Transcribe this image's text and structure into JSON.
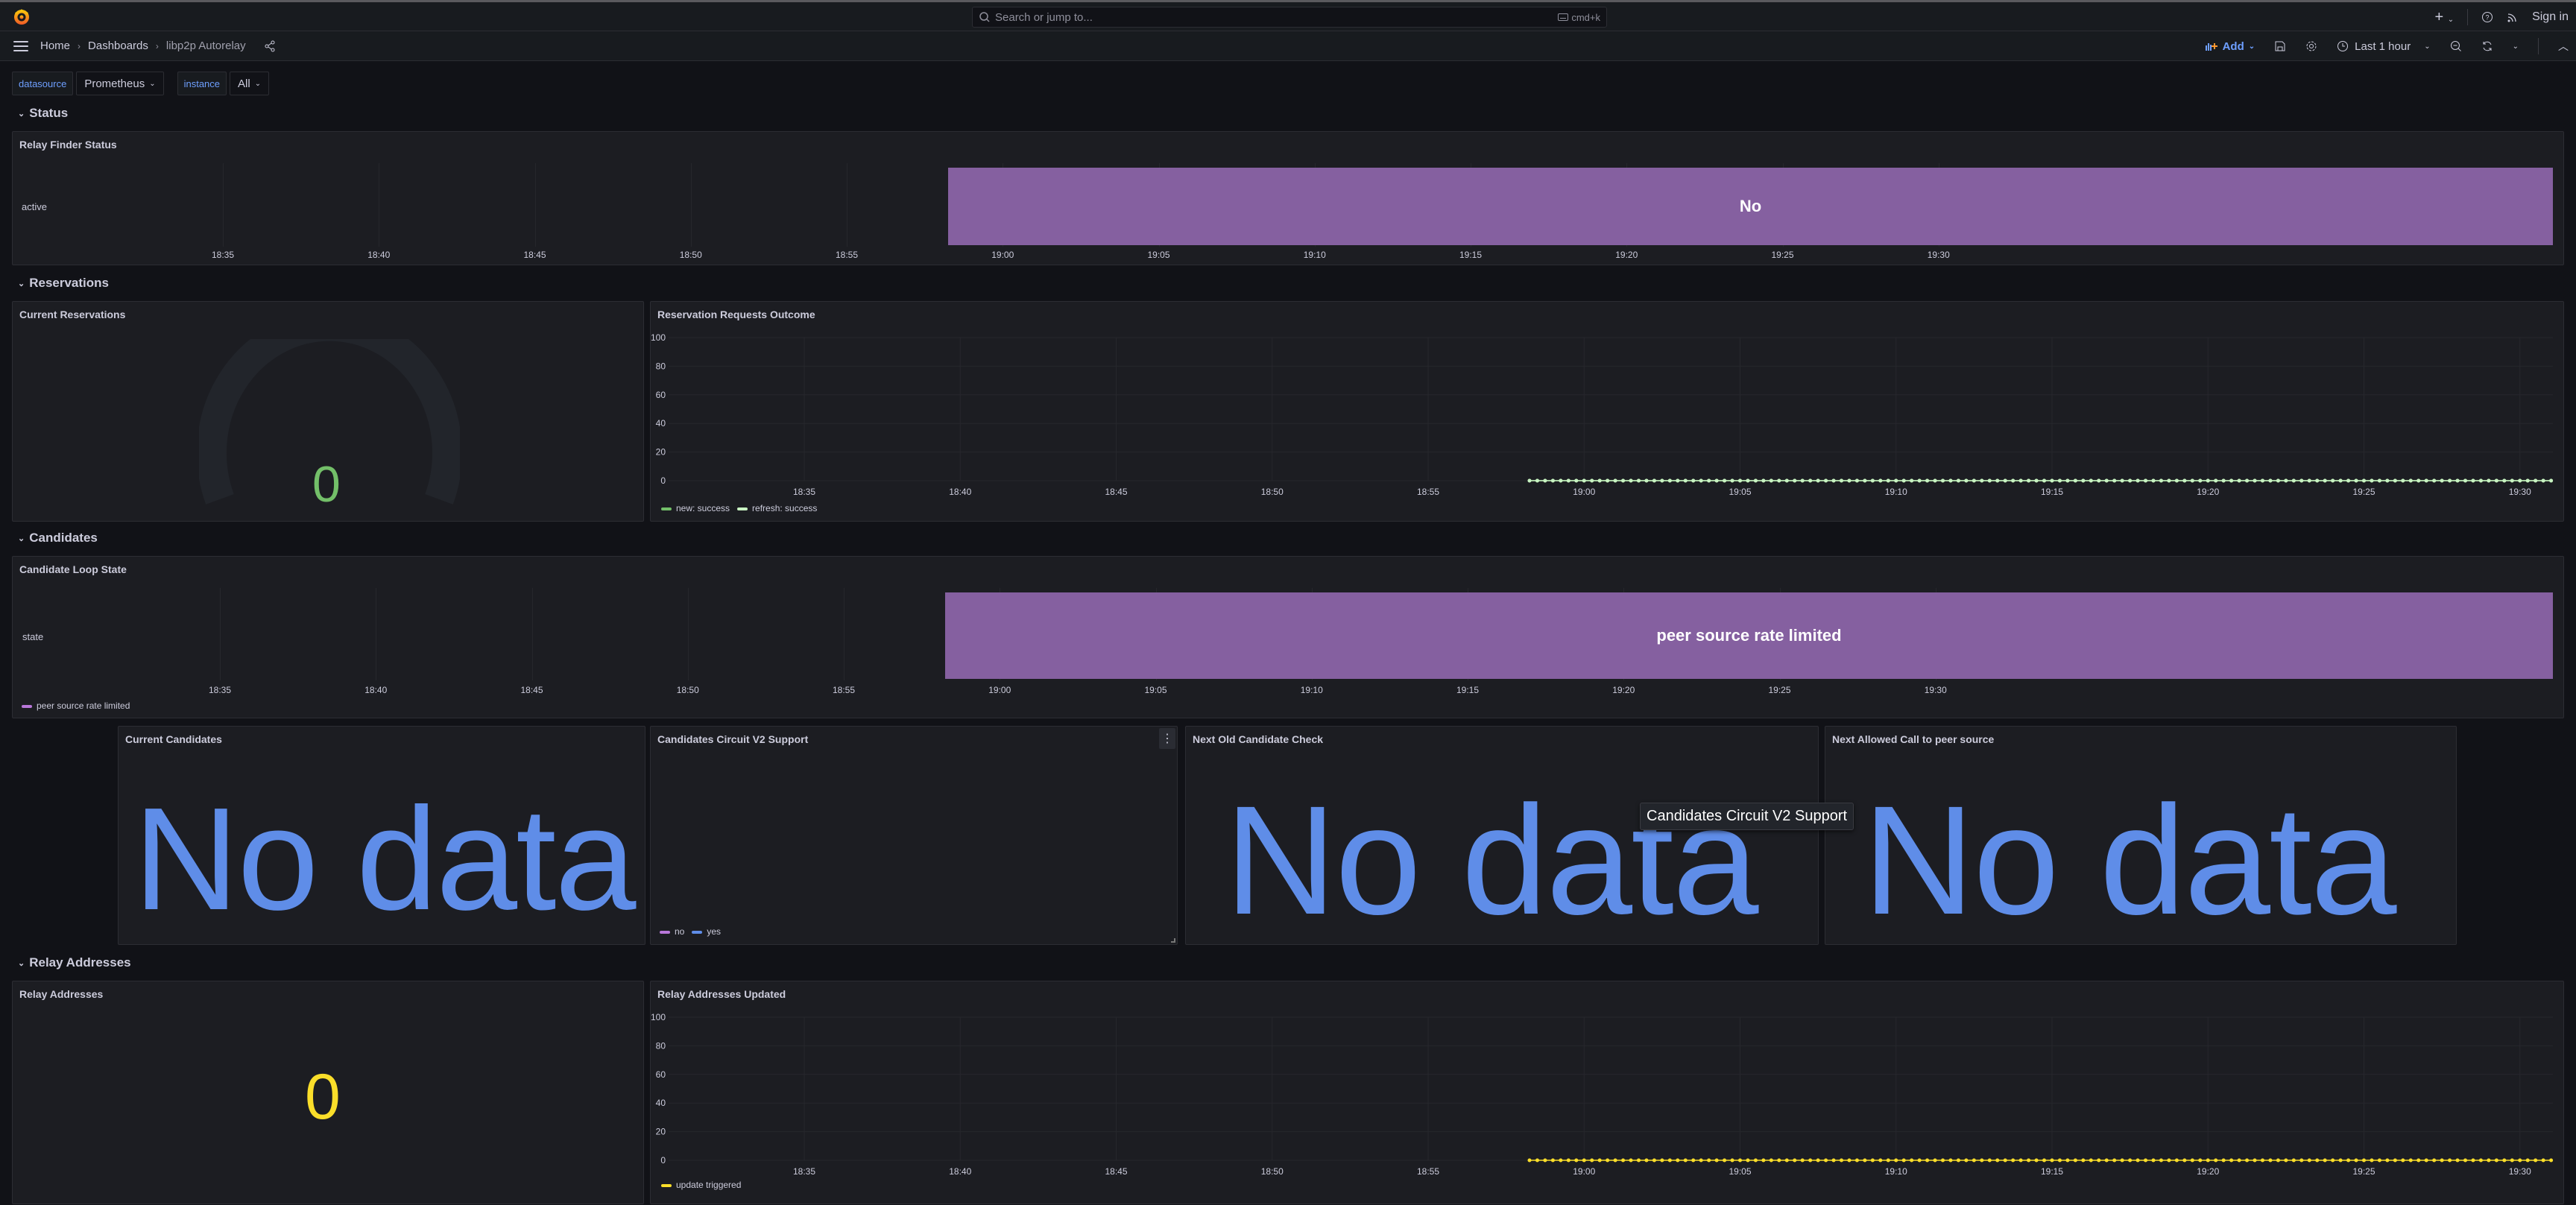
{
  "topbar": {
    "search_placeholder": "Search or jump to...",
    "search_shortcut": "cmd+k",
    "sign_in": "Sign in"
  },
  "navbar": {
    "breadcrumbs": [
      "Home",
      "Dashboards",
      "libp2p Autorelay"
    ],
    "add_label": "Add",
    "time_range": "Last 1 hour"
  },
  "variables": [
    {
      "label": "datasource",
      "value": "Prometheus"
    },
    {
      "label": "instance",
      "value": "All"
    }
  ],
  "rows": {
    "status": "Status",
    "reservations": "Reservations",
    "candidates": "Candidates",
    "relay_addresses": "Relay Addresses"
  },
  "panels": {
    "relay_finder_status": {
      "title": "Relay Finder Status",
      "row_label": "active",
      "state_text": "No"
    },
    "current_reservations": {
      "title": "Current Reservations",
      "value": "0",
      "color": "#73bf69"
    },
    "reservation_requests": {
      "title": "Reservation Requests Outcome"
    },
    "candidate_loop_state": {
      "title": "Candidate Loop State",
      "row_label": "state",
      "state_text": "peer source rate limited",
      "legend": "peer source rate limited"
    },
    "current_candidates": {
      "title": "Current Candidates",
      "value": "No data"
    },
    "candidates_circuit_v2": {
      "title": "Candidates Circuit V2 Support",
      "legend": [
        {
          "name": "no",
          "color": "#b877d9"
        },
        {
          "name": "yes",
          "color": "#5f8de8"
        }
      ]
    },
    "next_old_candidate_check": {
      "title": "Next Old Candidate Check",
      "value": "No data"
    },
    "next_allowed_call": {
      "title": "Next Allowed Call to peer source",
      "value": "No data"
    },
    "relay_addresses": {
      "title": "Relay Addresses",
      "value": "0",
      "color": "#fade2a"
    },
    "relay_addresses_updated": {
      "title": "Relay Addresses Updated"
    }
  },
  "tooltip": "Candidates Circuit V2 Support",
  "colors": {
    "accent": "#6e9fff",
    "state_purple": "#8560a0",
    "green": "#73bf69",
    "light_green": "#c8f2c2",
    "yellow": "#fade2a",
    "blue": "#5f8de8"
  },
  "chart_data": [
    {
      "type": "state-timeline",
      "title": "Relay Finder Status",
      "rows": [
        "active"
      ],
      "x_range": [
        "18:31",
        "19:31"
      ],
      "x_ticks": [
        "18:35",
        "18:40",
        "18:45",
        "18:50",
        "18:55",
        "19:00",
        "19:05",
        "19:10",
        "19:15",
        "19:20",
        "19:25",
        "19:30"
      ],
      "states": [
        {
          "row": "active",
          "start": "18:58:15",
          "end": "19:31",
          "value": "No",
          "color": "#8560a0"
        }
      ]
    },
    {
      "type": "line",
      "title": "Reservation Requests Outcome",
      "ylim": [
        0,
        100
      ],
      "y_ticks": [
        0,
        20,
        40,
        60,
        80,
        100
      ],
      "x_ticks": [
        "18:35",
        "18:40",
        "18:45",
        "18:50",
        "18:55",
        "19:00",
        "19:05",
        "19:10",
        "19:15",
        "19:20",
        "19:25",
        "19:30"
      ],
      "series": [
        {
          "name": "new: success",
          "color": "#73bf69",
          "start": "18:58:15",
          "end": "19:31",
          "interval_s": 15,
          "value": 0
        },
        {
          "name": "refresh: success",
          "color": "#c8f2c2",
          "start": "18:58:15",
          "end": "19:31",
          "interval_s": 15,
          "value": 0
        }
      ],
      "legend": "bottom-left"
    },
    {
      "type": "state-timeline",
      "title": "Candidate Loop State",
      "rows": [
        "state"
      ],
      "x_ticks": [
        "18:35",
        "18:40",
        "18:45",
        "18:50",
        "18:55",
        "19:00",
        "19:05",
        "19:10",
        "19:15",
        "19:20",
        "19:25",
        "19:30"
      ],
      "states": [
        {
          "row": "state",
          "start": "18:58:15",
          "end": "19:31",
          "value": "peer source rate limited",
          "color": "#8560a0"
        }
      ],
      "legend": [
        "peer source rate limited"
      ]
    },
    {
      "type": "line",
      "title": "Relay Addresses Updated",
      "ylim": [
        0,
        100
      ],
      "y_ticks": [
        0,
        20,
        40,
        60,
        80,
        100
      ],
      "x_ticks": [
        "18:35",
        "18:40",
        "18:45",
        "18:50",
        "18:55",
        "19:00",
        "19:05",
        "19:10",
        "19:15",
        "19:20",
        "19:25",
        "19:30"
      ],
      "series": [
        {
          "name": "update triggered",
          "color": "#fade2a",
          "start": "18:58:15",
          "end": "19:31",
          "interval_s": 15,
          "value": 0
        }
      ],
      "legend": "bottom-left"
    }
  ]
}
